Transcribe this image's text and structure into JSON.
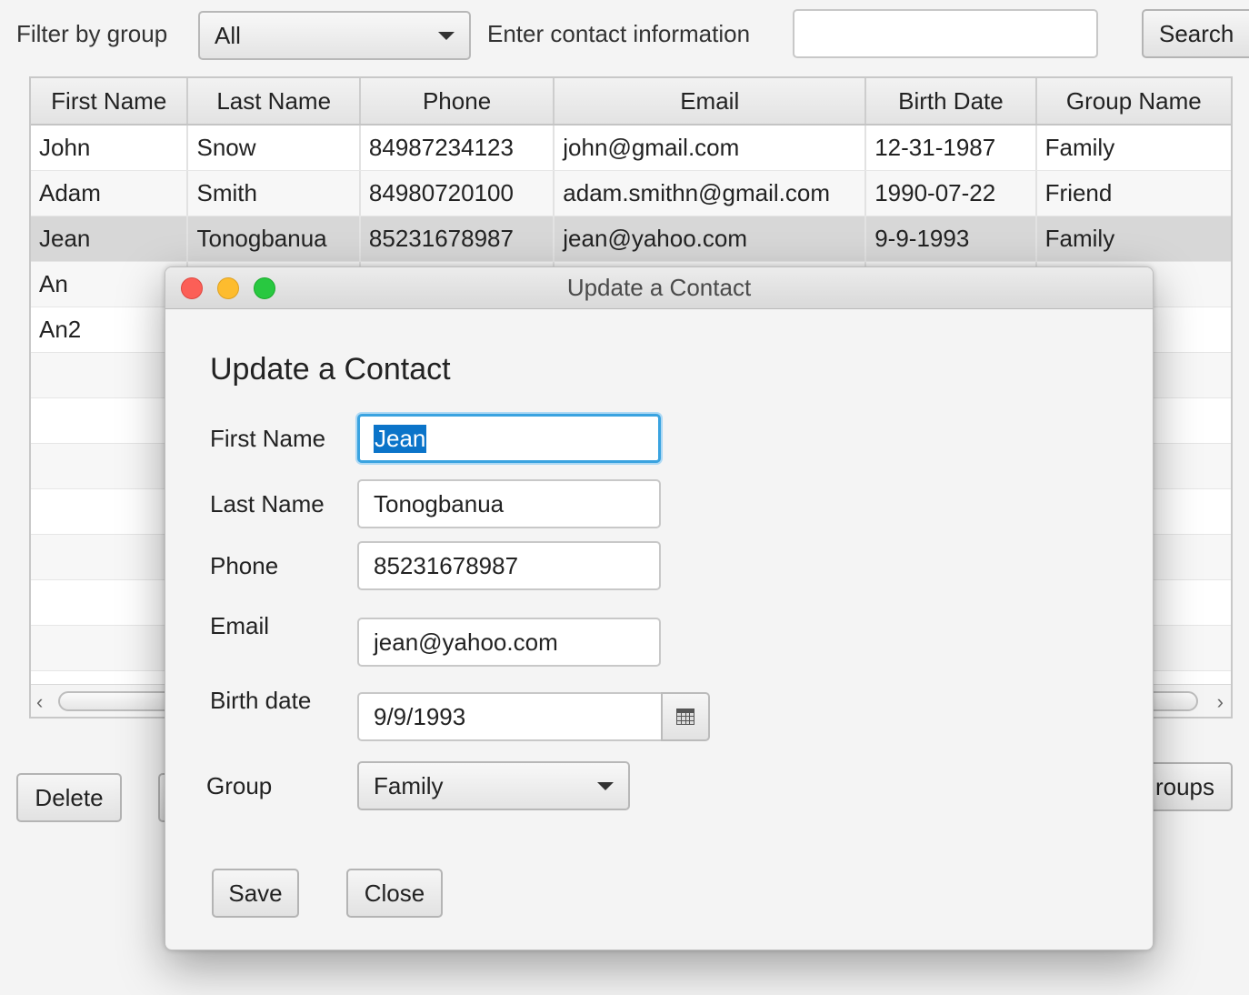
{
  "toolbar": {
    "filter_label": "Filter by group",
    "filter_value": "All",
    "contact_label": "Enter contact information",
    "contact_value": "",
    "search_button": "Search"
  },
  "table": {
    "columns": [
      "First Name",
      "Last Name",
      "Phone",
      "Email",
      "Birth Date",
      "Group Name"
    ],
    "rows": [
      [
        "John",
        "Snow",
        "84987234123",
        "john@gmail.com",
        "12-31-1987",
        "Family"
      ],
      [
        "Adam",
        "Smith",
        "84980720100",
        "adam.smithn@gmail.com",
        "1990-07-22",
        "Friend"
      ],
      [
        "Jean",
        "Tonogbanua",
        "85231678987",
        "jean@yahoo.com",
        "9-9-1993",
        "Family"
      ],
      [
        "An",
        "",
        "",
        "",
        "",
        ""
      ],
      [
        "An2",
        "",
        "",
        "",
        "",
        ""
      ]
    ],
    "selected_row": 2
  },
  "bottom": {
    "delete_button": "Delete",
    "groups_button_visible": "roups"
  },
  "dialog": {
    "window_title": "Update a Contact",
    "heading": "Update a Contact",
    "first_name_label": "First Name",
    "first_name_value": "Jean",
    "last_name_label": "Last Name",
    "last_name_value": "Tonogbanua",
    "phone_label": "Phone",
    "phone_value": "85231678987",
    "email_label": "Email",
    "email_value": "jean@yahoo.com",
    "birth_label": "Birth date",
    "birth_value": "9/9/1993",
    "group_label": "Group",
    "group_value": "Family",
    "save_button": "Save",
    "close_button": "Close"
  },
  "colors": {
    "selection": "#0b74c9",
    "focus_ring": "#3aa3e0",
    "close_light": "#fc5f57",
    "minimize_light": "#fdbc2e",
    "zoom_light": "#28c840"
  }
}
